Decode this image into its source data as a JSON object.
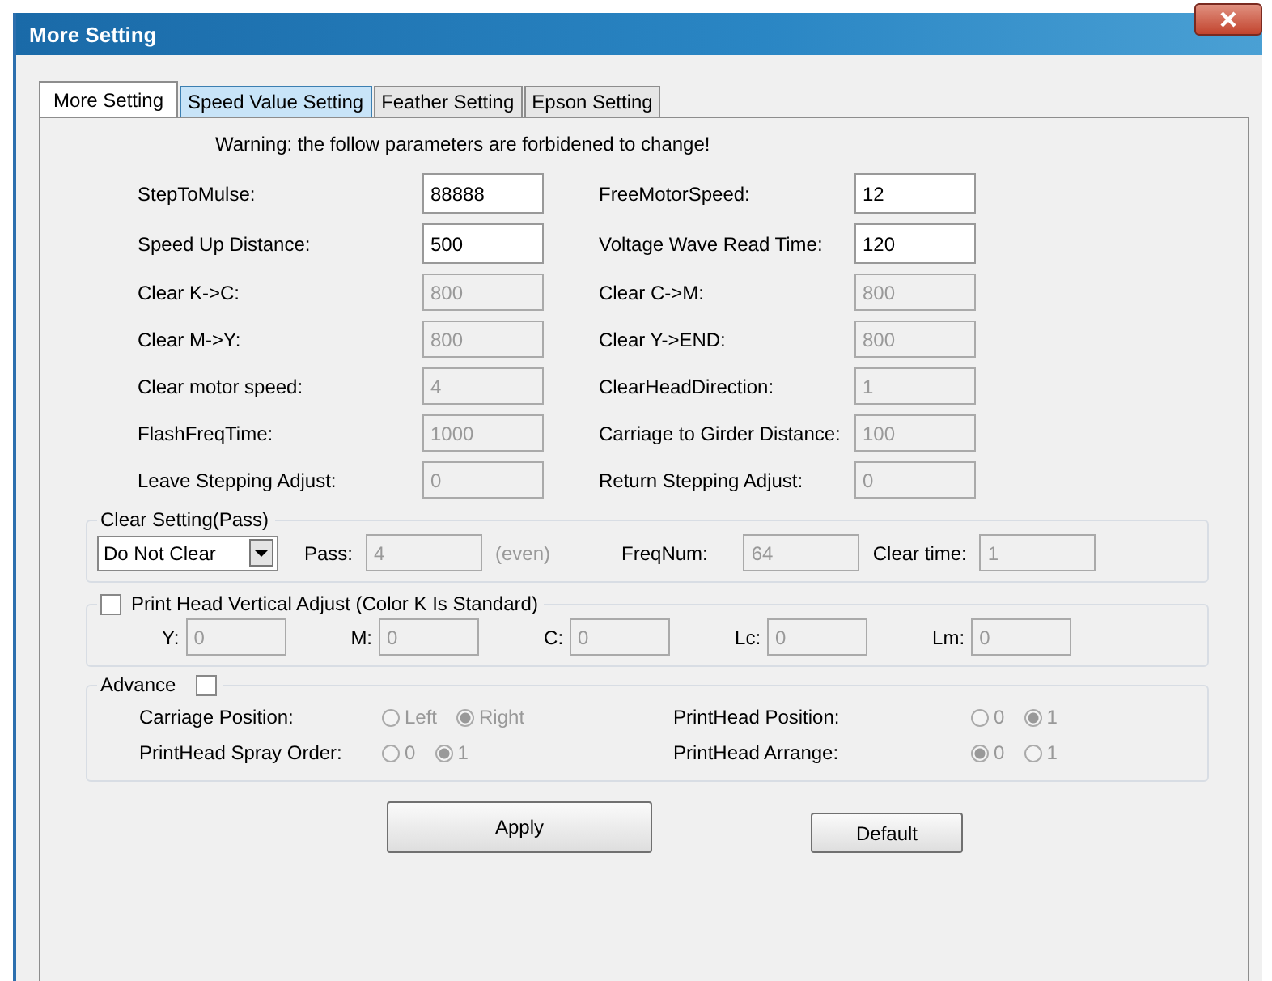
{
  "window": {
    "title": "More Setting"
  },
  "tabs": [
    {
      "label": "More Setting",
      "selected": true,
      "hover": false
    },
    {
      "label": "Speed Value Setting",
      "selected": false,
      "hover": true
    },
    {
      "label": "Feather Setting",
      "selected": false,
      "hover": false
    },
    {
      "label": "Epson Setting",
      "selected": false,
      "hover": false
    }
  ],
  "warning": "Warning: the follow parameters are forbidened to change!",
  "fields": [
    {
      "label": "StepToMulse:",
      "value": "88888",
      "disabled": false
    },
    {
      "label": "FreeMotorSpeed:",
      "value": "12",
      "disabled": false
    },
    {
      "label": "Speed Up Distance:",
      "value": "500",
      "disabled": false
    },
    {
      "label": "Voltage Wave Read Time:",
      "value": "120",
      "disabled": false
    },
    {
      "label": "Clear K->C:",
      "value": "800",
      "disabled": true
    },
    {
      "label": "Clear C->M:",
      "value": "800",
      "disabled": true
    },
    {
      "label": "Clear M->Y:",
      "value": "800",
      "disabled": true
    },
    {
      "label": "Clear Y->END:",
      "value": "800",
      "disabled": true
    },
    {
      "label": "Clear motor speed:",
      "value": "4",
      "disabled": true
    },
    {
      "label": "ClearHeadDirection:",
      "value": "1",
      "disabled": true
    },
    {
      "label": "FlashFreqTime:",
      "value": "1000",
      "disabled": true
    },
    {
      "label": "Carriage to Girder Distance:",
      "value": "100",
      "disabled": true
    },
    {
      "label": "Leave Stepping Adjust:",
      "value": "0",
      "disabled": true
    },
    {
      "label": "Return Stepping Adjust:",
      "value": "0",
      "disabled": true
    }
  ],
  "clear_setting": {
    "title": "Clear Setting(Pass)",
    "mode": "Do Not Clear",
    "pass": {
      "label": "Pass:",
      "value": "4",
      "hint": "(even)"
    },
    "freq": {
      "label": "FreqNum:",
      "value": "64"
    },
    "clear_time": {
      "label": "Clear time:",
      "value": "1"
    }
  },
  "vertical_adjust": {
    "label": "Print Head Vertical Adjust (Color K Is Standard)",
    "checked": false,
    "fields": [
      {
        "label": "Y:",
        "value": "0"
      },
      {
        "label": "M:",
        "value": "0"
      },
      {
        "label": "C:",
        "value": "0"
      },
      {
        "label": "Lc:",
        "value": "0"
      },
      {
        "label": "Lm:",
        "value": "0"
      }
    ]
  },
  "advance": {
    "label": "Advance",
    "checked": false,
    "groups": [
      {
        "label": "Carriage Position:",
        "options": [
          {
            "label": "Left",
            "selected": false
          },
          {
            "label": "Right",
            "selected": true
          }
        ]
      },
      {
        "label": "PrintHead Position:",
        "options": [
          {
            "label": "0",
            "selected": false
          },
          {
            "label": "1",
            "selected": true
          }
        ]
      },
      {
        "label": "PrintHead Spray Order:",
        "options": [
          {
            "label": "0",
            "selected": false
          },
          {
            "label": "1",
            "selected": true
          }
        ]
      },
      {
        "label": "PrintHead Arrange:",
        "options": [
          {
            "label": "0",
            "selected": true
          },
          {
            "label": "1",
            "selected": false
          }
        ]
      }
    ]
  },
  "buttons": [
    {
      "label": "Apply",
      "kind": "large"
    },
    {
      "label": "Default",
      "kind": "small"
    }
  ]
}
